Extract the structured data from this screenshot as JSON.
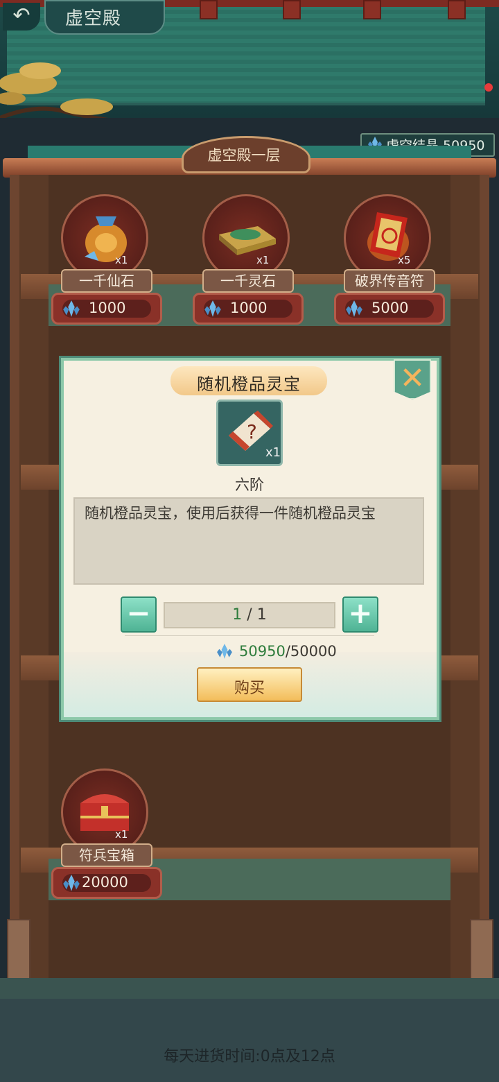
{
  "header": {
    "back_icon": "back-arrow-icon",
    "title": "虚空殿"
  },
  "currency": {
    "icon": "void-crystal-icon",
    "label": "虚空结晶",
    "amount": "50950"
  },
  "floor": {
    "title": "虚空殿一层"
  },
  "shop_items": [
    {
      "name": "一千仙石",
      "qty": "x1",
      "price": "1000",
      "icon": "spirit-stone-bag-icon"
    },
    {
      "name": "一千灵石",
      "qty": "x1",
      "price": "1000",
      "icon": "jade-stone-box-icon"
    },
    {
      "name": "破界传音符",
      "qty": "x5",
      "price": "5000",
      "icon": "talisman-icon"
    },
    {
      "name": "符兵宝箱",
      "qty": "x1",
      "price": "20000",
      "icon": "treasure-chest-icon"
    }
  ],
  "popup": {
    "title": "随机橙品灵宝",
    "item_qty": "x1",
    "item_icon": "mystery-scroll-icon",
    "tier": "六阶",
    "description": "随机橙品灵宝，使用后获得一件随机橙品灵宝",
    "quantity_current": "1",
    "quantity_sep": " / ",
    "quantity_max": "1",
    "minus_label": "−",
    "plus_label": "+",
    "cost_have": "50950",
    "cost_need": "/50000",
    "buy_label": "购买",
    "close_icon": "close-icon"
  },
  "footer": {
    "restock_text": "每天进货时间:0点及12点"
  },
  "colors": {
    "accent_green": "#2e7c3c",
    "price_red": "#8a3128",
    "popup_bg": "#f6f0e1"
  }
}
